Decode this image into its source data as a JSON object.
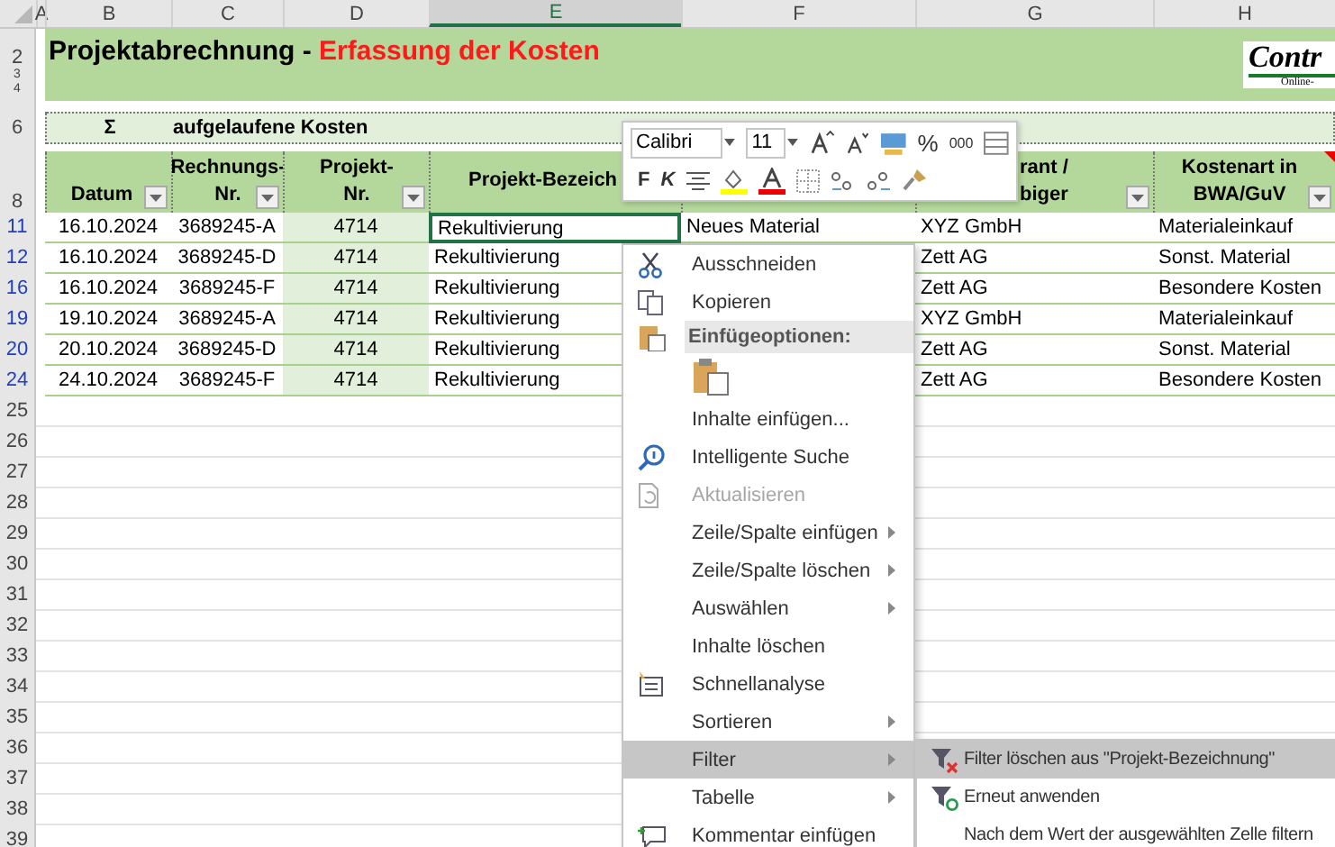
{
  "column_headers": [
    {
      "letter": "A",
      "selected": false
    },
    {
      "letter": "B",
      "selected": false
    },
    {
      "letter": "C",
      "selected": false
    },
    {
      "letter": "D",
      "selected": false
    },
    {
      "letter": "E",
      "selected": true
    },
    {
      "letter": "F",
      "selected": false
    },
    {
      "letter": "G",
      "selected": false
    },
    {
      "letter": "H",
      "selected": false
    }
  ],
  "title": {
    "main": "Projektabrechnung - ",
    "highlight": "Erfassung der Kosten",
    "row_labels": [
      "2",
      "3",
      "4"
    ]
  },
  "logo": {
    "text": "Contr",
    "subtext": "Online-"
  },
  "summary_row": {
    "row": "6",
    "sigma": "Σ",
    "label": "aufgelaufene Kosten"
  },
  "header_row": {
    "row": "8",
    "cells": [
      {
        "lines": [
          "Datum"
        ],
        "filter_button": true
      },
      {
        "lines": [
          "Rechnungs-",
          "Nr."
        ],
        "filter_button": true
      },
      {
        "lines": [
          "Projekt-",
          "Nr."
        ],
        "filter_button": true
      },
      {
        "lines": [
          "Projekt-Bezeich"
        ],
        "filter_button": false
      },
      {
        "filter_button": false
      },
      {
        "lines": [
          "rant /",
          "biger"
        ],
        "filter_button": true
      },
      {
        "lines": [
          "Kostenart in",
          "BWA/GuV"
        ],
        "filter_button": true,
        "comment": true
      }
    ]
  },
  "rows": [
    {
      "row": "11",
      "filtered": true,
      "active": true,
      "datum": "16.10.2024",
      "rechnungs_nr": "3689245-A",
      "projekt_nr": "4714",
      "projekt_bezeichnung": "Rekultivierung",
      "column_f": "Neues Material",
      "column_g": "XYZ GmbH",
      "kostenart": "Materialeinkauf"
    },
    {
      "row": "12",
      "filtered": true,
      "active": false,
      "datum": "16.10.2024",
      "rechnungs_nr": "3689245-D",
      "projekt_nr": "4714",
      "projekt_bezeichnung": "Rekultivierung",
      "column_g": "Zett AG",
      "kostenart": "Sonst. Material"
    },
    {
      "row": "16",
      "filtered": true,
      "active": false,
      "datum": "16.10.2024",
      "rechnungs_nr": "3689245-F",
      "projekt_nr": "4714",
      "projekt_bezeichnung": "Rekultivierung",
      "column_g": "Zett AG",
      "kostenart": "Besondere Kosten"
    },
    {
      "row": "19",
      "filtered": true,
      "active": false,
      "datum": "19.10.2024",
      "rechnungs_nr": "3689245-A",
      "projekt_nr": "4714",
      "projekt_bezeichnung": "Rekultivierung",
      "column_g": "XYZ GmbH",
      "kostenart": "Materialeinkauf"
    },
    {
      "row": "20",
      "filtered": true,
      "active": false,
      "datum": "20.10.2024",
      "rechnungs_nr": "3689245-D",
      "projekt_nr": "4714",
      "projekt_bezeichnung": "Rekultivierung",
      "column_g": "Zett AG",
      "kostenart": "Sonst. Material"
    },
    {
      "row": "24",
      "filtered": true,
      "active": false,
      "datum": "24.10.2024",
      "rechnungs_nr": "3689245-F",
      "projekt_nr": "4714",
      "projekt_bezeichnung": "Rekultivierung",
      "column_g": "Zett AG",
      "kostenart": "Besondere Kosten"
    }
  ],
  "empty_rows": [
    "25",
    "26",
    "27",
    "28",
    "29",
    "30",
    "31",
    "32",
    "33",
    "34",
    "35",
    "36",
    "37",
    "38",
    "39"
  ],
  "mini_toolbar": {
    "font": "Calibri",
    "size": "11",
    "percent": "%",
    "thousands": "000",
    "bold": "F",
    "italic": "K"
  },
  "context_menu": [
    {
      "kind": "item",
      "label": "Ausschneiden",
      "disabled": false,
      "submenu": false,
      "selected": false
    },
    {
      "kind": "item",
      "label": "Kopieren",
      "disabled": false,
      "submenu": false,
      "selected": false
    },
    {
      "kind": "header",
      "label": "Einfügeoptionen:"
    },
    {
      "kind": "paste-options"
    },
    {
      "kind": "item",
      "label": "Inhalte einfügen...",
      "disabled": false,
      "submenu": false,
      "selected": false
    },
    {
      "kind": "item",
      "label": "Intelligente Suche",
      "disabled": false,
      "submenu": false,
      "selected": false
    },
    {
      "kind": "item",
      "label": "Aktualisieren",
      "disabled": true,
      "submenu": false,
      "selected": false
    },
    {
      "kind": "item",
      "label": "Zeile/Spalte einfügen",
      "disabled": false,
      "submenu": true,
      "selected": false
    },
    {
      "kind": "item",
      "label": "Zeile/Spalte löschen",
      "disabled": false,
      "submenu": true,
      "selected": false
    },
    {
      "kind": "item",
      "label": "Auswählen",
      "disabled": false,
      "submenu": true,
      "selected": false
    },
    {
      "kind": "item",
      "label": "Inhalte löschen",
      "disabled": false,
      "submenu": false,
      "selected": false
    },
    {
      "kind": "item",
      "label": "Schnellanalyse",
      "disabled": false,
      "submenu": false,
      "selected": false
    },
    {
      "kind": "item",
      "label": "Sortieren",
      "disabled": false,
      "submenu": true,
      "selected": false
    },
    {
      "kind": "item",
      "label": "Filter",
      "disabled": false,
      "submenu": true,
      "selected": true
    },
    {
      "kind": "item",
      "label": "Tabelle",
      "disabled": false,
      "submenu": true,
      "selected": false
    },
    {
      "kind": "item",
      "label": "Kommentar einfügen",
      "disabled": false,
      "submenu": false,
      "selected": false
    }
  ],
  "submenu": [
    {
      "label": "Filter löschen aus \"Projekt-Bezeichnung\"",
      "selected": true
    },
    {
      "label": "Erneut anwenden",
      "selected": false
    },
    {
      "label": "Nach dem Wert der ausgewählten Zelle filtern",
      "selected": false
    }
  ]
}
